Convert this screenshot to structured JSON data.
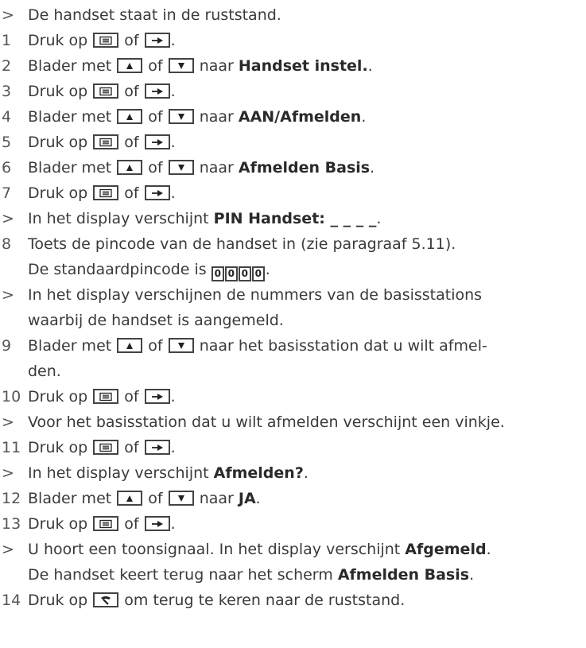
{
  "keys": {
    "menu": "menu-key",
    "right": "right-arrow-key",
    "up": "up-key",
    "down": "down-key",
    "end": "end-call-key"
  },
  "steps": [
    {
      "m": ">",
      "lines": [
        [
          {
            "t": "De handset staat in de ruststand."
          }
        ]
      ]
    },
    {
      "m": "1",
      "lines": [
        [
          {
            "t": "Druk op "
          },
          {
            "k": "menu"
          },
          {
            "t": " of "
          },
          {
            "k": "right"
          },
          {
            "t": "."
          }
        ]
      ]
    },
    {
      "m": "2",
      "lines": [
        [
          {
            "t": "Blader met "
          },
          {
            "k": "up"
          },
          {
            "t": " of "
          },
          {
            "k": "down"
          },
          {
            "t": " naar "
          },
          {
            "b": "Handset instel."
          },
          {
            "t": "."
          }
        ]
      ]
    },
    {
      "m": "3",
      "lines": [
        [
          {
            "t": "Druk op "
          },
          {
            "k": "menu"
          },
          {
            "t": " of "
          },
          {
            "k": "right"
          },
          {
            "t": "."
          }
        ]
      ]
    },
    {
      "m": "4",
      "lines": [
        [
          {
            "t": "Blader met "
          },
          {
            "k": "up"
          },
          {
            "t": " of "
          },
          {
            "k": "down"
          },
          {
            "t": " naar "
          },
          {
            "b": "AAN/Afmelden"
          },
          {
            "t": "."
          }
        ]
      ]
    },
    {
      "m": "5",
      "lines": [
        [
          {
            "t": "Druk op "
          },
          {
            "k": "menu"
          },
          {
            "t": " of "
          },
          {
            "k": "right"
          },
          {
            "t": "."
          }
        ]
      ]
    },
    {
      "m": "6",
      "lines": [
        [
          {
            "t": "Blader met "
          },
          {
            "k": "up"
          },
          {
            "t": " of "
          },
          {
            "k": "down"
          },
          {
            "t": " naar "
          },
          {
            "b": "Afmelden Basis"
          },
          {
            "t": "."
          }
        ]
      ]
    },
    {
      "m": "7",
      "lines": [
        [
          {
            "t": "Druk op "
          },
          {
            "k": "menu"
          },
          {
            "t": " of "
          },
          {
            "k": "right"
          },
          {
            "t": "."
          }
        ]
      ]
    },
    {
      "m": ">",
      "lines": [
        [
          {
            "t": "In het display verschijnt "
          },
          {
            "b": "PIN Handset: _ _ _ _"
          },
          {
            "t": "."
          }
        ]
      ]
    },
    {
      "m": "8",
      "lines": [
        [
          {
            "t": "Toets de pincode van de handset in (zie paragraaf 5.11)."
          }
        ],
        [
          {
            "t": "De standaardpincode is "
          },
          {
            "d": "0"
          },
          {
            "d": "0"
          },
          {
            "d": "0"
          },
          {
            "d": "0"
          },
          {
            "t": "."
          }
        ]
      ]
    },
    {
      "m": ">",
      "lines": [
        [
          {
            "t": "In het display verschijnen de nummers van de basisstations"
          }
        ],
        [
          {
            "t": "waarbij de handset is aangemeld."
          }
        ]
      ]
    },
    {
      "m": "9",
      "lines": [
        [
          {
            "t": "Blader met "
          },
          {
            "k": "up"
          },
          {
            "t": " of "
          },
          {
            "k": "down"
          },
          {
            "t": " naar het basisstation dat u wilt afmel-"
          }
        ],
        [
          {
            "t": "den."
          }
        ]
      ]
    },
    {
      "m": "10",
      "lines": [
        [
          {
            "t": "Druk op "
          },
          {
            "k": "menu"
          },
          {
            "t": " of "
          },
          {
            "k": "right"
          },
          {
            "t": "."
          }
        ]
      ]
    },
    {
      "m": ">",
      "lines": [
        [
          {
            "t": "Voor het basisstation dat u wilt afmelden verschijnt een vinkje."
          }
        ]
      ]
    },
    {
      "m": "11",
      "lines": [
        [
          {
            "t": "Druk op "
          },
          {
            "k": "menu"
          },
          {
            "t": " of "
          },
          {
            "k": "right"
          },
          {
            "t": "."
          }
        ]
      ]
    },
    {
      "m": ">",
      "lines": [
        [
          {
            "t": "In het display verschijnt "
          },
          {
            "b": "Afmelden?"
          },
          {
            "t": "."
          }
        ]
      ]
    },
    {
      "m": "12",
      "lines": [
        [
          {
            "t": "Blader met "
          },
          {
            "k": "up"
          },
          {
            "t": " of "
          },
          {
            "k": "down"
          },
          {
            "t": " naar "
          },
          {
            "b": "JA"
          },
          {
            "t": "."
          }
        ]
      ]
    },
    {
      "m": "13",
      "lines": [
        [
          {
            "t": "Druk op "
          },
          {
            "k": "menu"
          },
          {
            "t": " of "
          },
          {
            "k": "right"
          },
          {
            "t": "."
          }
        ]
      ]
    },
    {
      "m": ">",
      "lines": [
        [
          {
            "t": "U hoort een toonsignaal. In het display verschijnt "
          },
          {
            "b": "Afgemeld"
          },
          {
            "t": "."
          }
        ],
        [
          {
            "t": "De handset keert terug naar het scherm "
          },
          {
            "b": "Afmelden Basis"
          },
          {
            "t": "."
          }
        ]
      ]
    },
    {
      "m": "14",
      "lines": [
        [
          {
            "t": "Druk op "
          },
          {
            "k": "end"
          },
          {
            "t": " om terug te keren naar de ruststand."
          }
        ]
      ]
    }
  ]
}
